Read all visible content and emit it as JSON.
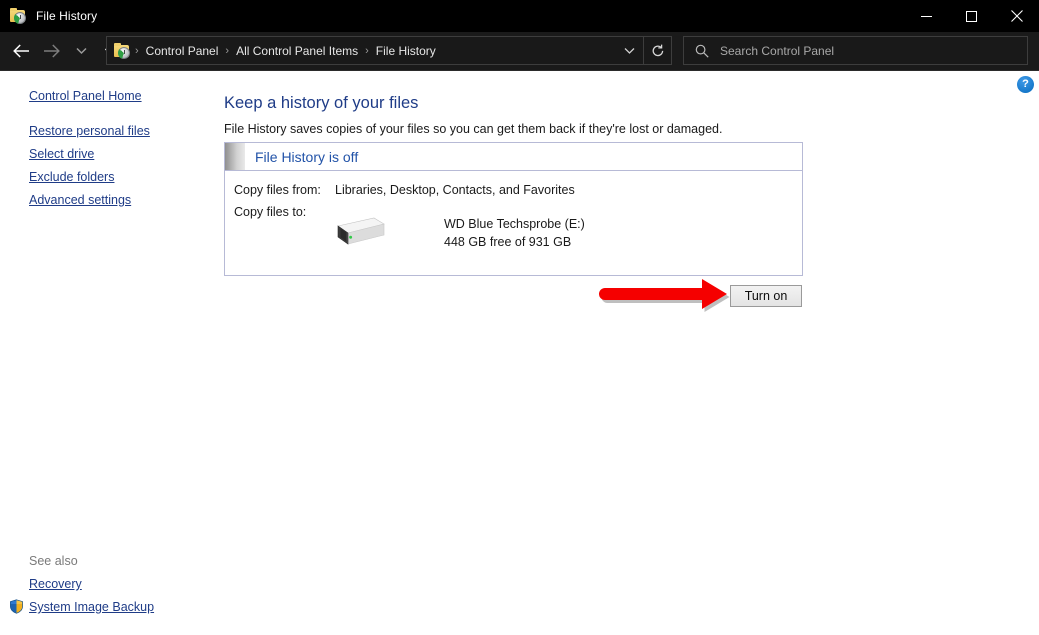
{
  "window": {
    "title": "File History",
    "icon": "file-history-icon",
    "controls": {
      "minimize": "minimize",
      "maximize": "maximize",
      "close": "close"
    }
  },
  "toolbar": {
    "back": "back",
    "forward": "forward",
    "recent_dropdown": "recent-locations",
    "up": "up-one-level",
    "address": {
      "icon": "file-history-icon",
      "crumbs": [
        "Control Panel",
        "All Control Panel Items",
        "File History"
      ],
      "separator": "›",
      "dropdown": "address-dropdown",
      "refresh": "refresh"
    },
    "search": {
      "icon": "search-icon",
      "placeholder": "Search Control Panel",
      "value": ""
    }
  },
  "sidebar": {
    "home": "Control Panel Home",
    "items": [
      {
        "label": "Restore personal files"
      },
      {
        "label": "Select drive"
      },
      {
        "label": "Exclude folders"
      },
      {
        "label": "Advanced settings"
      }
    ],
    "see_also_label": "See also",
    "see_also": [
      {
        "label": "Recovery",
        "icon": null
      },
      {
        "label": "System Image Backup",
        "icon": "shield-icon"
      }
    ]
  },
  "main": {
    "title": "Keep a history of your files",
    "description": "File History saves copies of your files so you can get them back if they're lost or damaged.",
    "status": {
      "heading": "File History is off",
      "copy_from_label": "Copy files from:",
      "copy_from_value": "Libraries, Desktop, Contacts, and Favorites",
      "copy_to_label": "Copy files to:",
      "drive_icon": "external-drive-icon",
      "drive_name": "WD Blue Techsprobe (E:)",
      "drive_free": "448 GB free of 931 GB"
    },
    "turn_on_label": "Turn on",
    "help_label": "?"
  },
  "annotation": {
    "arrow": "red-arrow-pointing-to-turn-on-button",
    "color": "#f50000"
  },
  "colors": {
    "link": "#1f3c87",
    "heading": "#1f3c87",
    "status_heading": "#2253a8",
    "panel_border": "#b7bad6",
    "titlebar_bg": "#000000",
    "toolbar_bg": "#1a1a1a",
    "annotation_red": "#f50000"
  }
}
